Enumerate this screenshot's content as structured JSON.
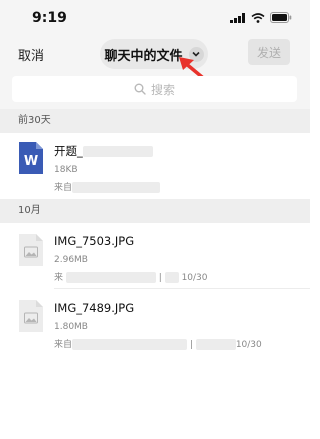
{
  "status_bar": {
    "time": "9:19",
    "icons": [
      "signal-icon",
      "wifi-icon",
      "battery-icon"
    ]
  },
  "nav": {
    "cancel_label": "取消",
    "title": "聊天中的文件",
    "send_label": "发送"
  },
  "search": {
    "placeholder": "搜索"
  },
  "sections": [
    {
      "label": "前30天",
      "files": [
        {
          "name": "开题_",
          "size": "18KB",
          "source_prefix": "来自",
          "icon": "word-doc-icon"
        }
      ]
    },
    {
      "label": "10月",
      "files": [
        {
          "name": "IMG_7503.JPG",
          "size": "2.96MB",
          "source_prefix": "来",
          "source_separator": "|",
          "date": "10/30",
          "icon": "image-file-icon"
        },
        {
          "name": "IMG_7489.JPG",
          "size": "1.80MB",
          "source_prefix": "来自",
          "source_separator": "|",
          "date": "10/30",
          "icon": "image-file-icon"
        }
      ]
    }
  ],
  "colors": {
    "background": "#f5f5f5",
    "word_blue": "#3a5bb5",
    "arrow_red": "#e8322b",
    "send_disabled": "#b0b0b0"
  }
}
